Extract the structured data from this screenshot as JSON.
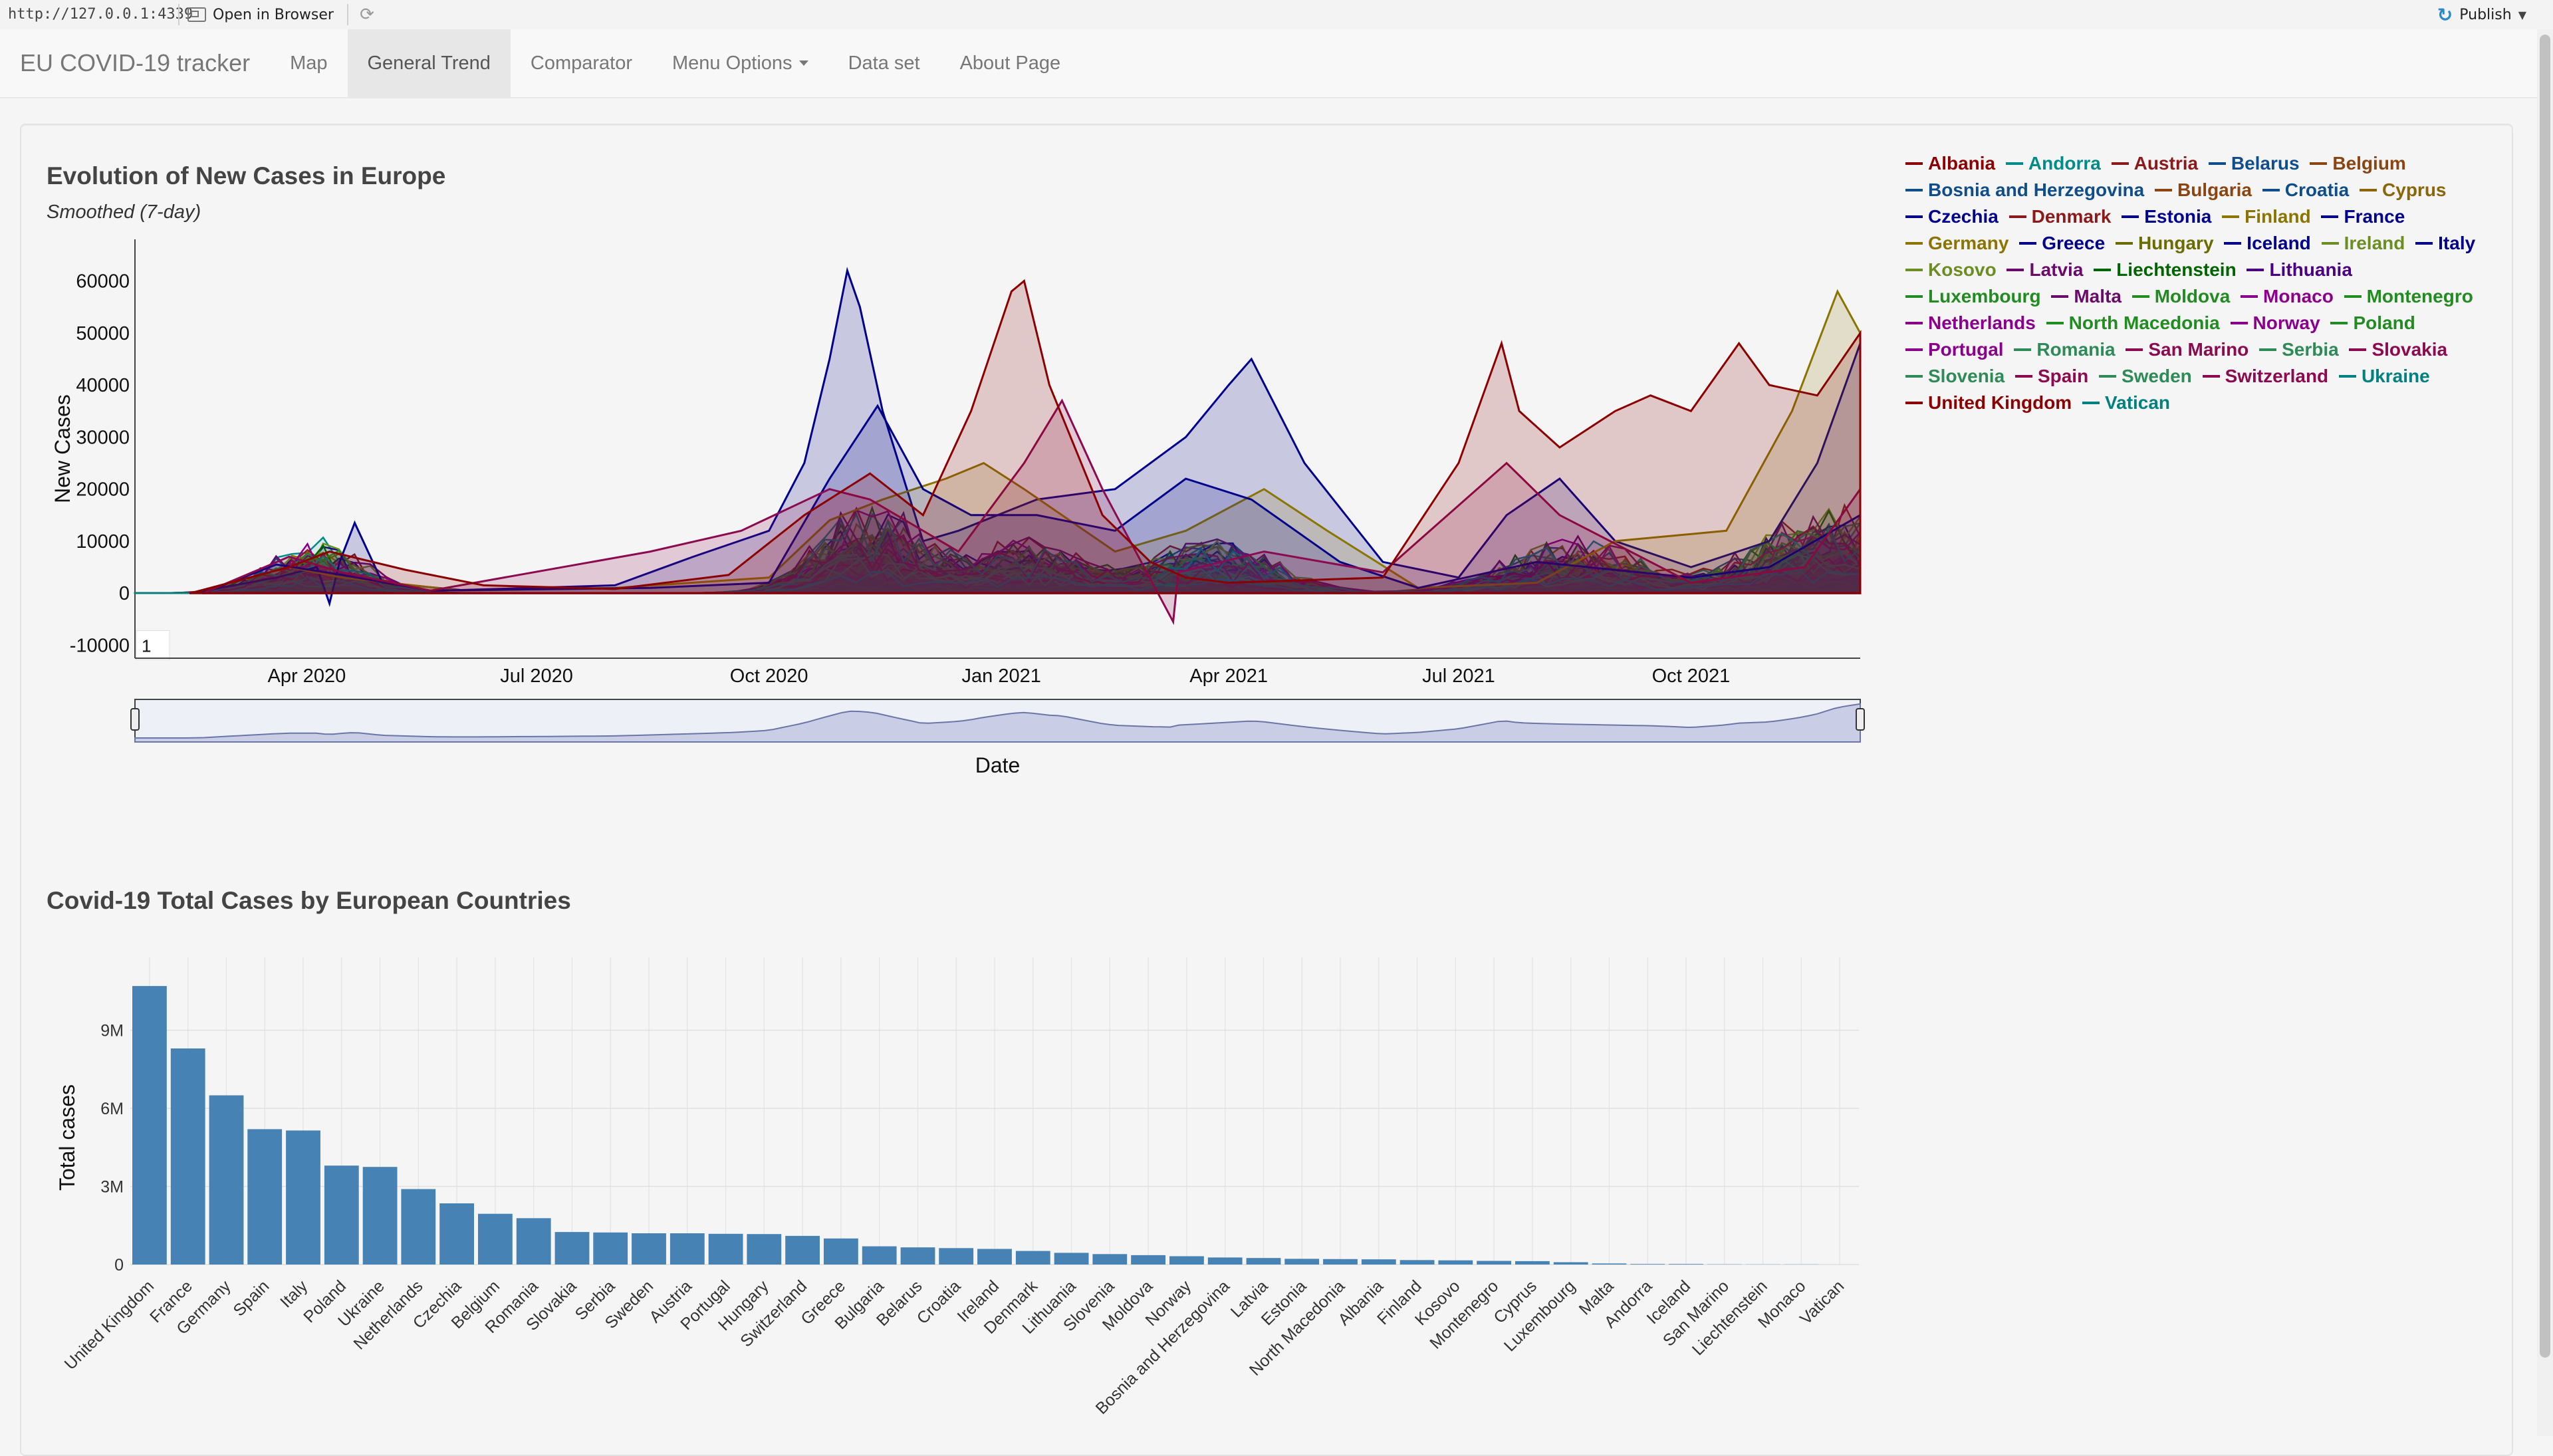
{
  "viewer": {
    "url": "http://127.0.0.1:4339",
    "open_in_browser": "Open in Browser",
    "publish": "Publish"
  },
  "navbar": {
    "brand": "EU COVID-19 tracker",
    "items": [
      {
        "label": "Map",
        "active": false
      },
      {
        "label": "General Trend",
        "active": true
      },
      {
        "label": "Comparator",
        "active": false
      },
      {
        "label": "Menu Options",
        "active": false,
        "dropdown": true
      },
      {
        "label": "Data set",
        "active": false
      },
      {
        "label": "About Page",
        "active": false
      }
    ]
  },
  "colors": {
    "bar": "#4682b4",
    "accent_nav_active": "#e7e7e7"
  },
  "chart_data": [
    {
      "type": "area",
      "title": "Evolution of New Cases in Europe",
      "subtitle": "Smoothed (7-day)",
      "xlabel": "Date",
      "ylabel": "New Cases",
      "yticks": [
        60000,
        50000,
        40000,
        30000,
        20000,
        10000,
        0,
        -10000
      ],
      "ylim": [
        -12500,
        68000
      ],
      "xlim": [
        "2020-01-24",
        "2021-12-07"
      ],
      "xticks": [
        {
          "label": "Apr 2020",
          "date": "2020-04-01"
        },
        {
          "label": "Jul 2020",
          "date": "2020-07-01"
        },
        {
          "label": "Oct 2020",
          "date": "2020-10-01"
        },
        {
          "label": "Jan 2021",
          "date": "2021-01-01"
        },
        {
          "label": "Apr 2021",
          "date": "2021-04-01"
        },
        {
          "label": "Jul 2021",
          "date": "2021-07-01"
        },
        {
          "label": "Oct 2021",
          "date": "2021-10-01"
        }
      ],
      "grid": false,
      "legend_position": "right",
      "input_box_value": "1",
      "series": [
        {
          "name": "Albania",
          "color": "#8b0000"
        },
        {
          "name": "Andorra",
          "color": "#008b8b"
        },
        {
          "name": "Austria",
          "color": "#8b1a1a"
        },
        {
          "name": "Belarus",
          "color": "#104e8b"
        },
        {
          "name": "Belgium",
          "color": "#8b4513"
        },
        {
          "name": "Bosnia and Herzegovina",
          "color": "#104e8b"
        },
        {
          "name": "Bulgaria",
          "color": "#8b4513"
        },
        {
          "name": "Croatia",
          "color": "#104e8b"
        },
        {
          "name": "Cyprus",
          "color": "#8b6508"
        },
        {
          "name": "Czechia",
          "color": "#00008b"
        },
        {
          "name": "Denmark",
          "color": "#8b1a1a"
        },
        {
          "name": "Estonia",
          "color": "#00008b"
        },
        {
          "name": "Finland",
          "color": "#8b7500"
        },
        {
          "name": "France",
          "color": "#00008b"
        },
        {
          "name": "Germany",
          "color": "#8b7500"
        },
        {
          "name": "Greece",
          "color": "#00008b"
        },
        {
          "name": "Hungary",
          "color": "#6b6b00"
        },
        {
          "name": "Iceland",
          "color": "#00008b"
        },
        {
          "name": "Ireland",
          "color": "#6b8e23"
        },
        {
          "name": "Italy",
          "color": "#00008b"
        },
        {
          "name": "Kosovo",
          "color": "#6b8e23"
        },
        {
          "name": "Latvia",
          "color": "#6a0a6a"
        },
        {
          "name": "Liechtenstein",
          "color": "#006400"
        },
        {
          "name": "Lithuania",
          "color": "#4b0082"
        },
        {
          "name": "Luxembourg",
          "color": "#228b22"
        },
        {
          "name": "Malta",
          "color": "#6a0a6a"
        },
        {
          "name": "Moldova",
          "color": "#228b22"
        },
        {
          "name": "Monaco",
          "color": "#8b008b"
        },
        {
          "name": "Montenegro",
          "color": "#228b22"
        },
        {
          "name": "Netherlands",
          "color": "#8b008b"
        },
        {
          "name": "North Macedonia",
          "color": "#228b22"
        },
        {
          "name": "Norway",
          "color": "#8b008b"
        },
        {
          "name": "Poland",
          "color": "#228b22"
        },
        {
          "name": "Portugal",
          "color": "#8b008b"
        },
        {
          "name": "Romania",
          "color": "#2e8b57"
        },
        {
          "name": "San Marino",
          "color": "#8b0a50"
        },
        {
          "name": "Serbia",
          "color": "#2e8b57"
        },
        {
          "name": "Slovakia",
          "color": "#8b0a50"
        },
        {
          "name": "Slovenia",
          "color": "#2e8b57"
        },
        {
          "name": "Spain",
          "color": "#8b0a50"
        },
        {
          "name": "Sweden",
          "color": "#2e8b57"
        },
        {
          "name": "Switzerland",
          "color": "#8b0a50"
        },
        {
          "name": "Ukraine",
          "color": "#008080"
        },
        {
          "name": "United Kingdom",
          "color": "#8b0000"
        },
        {
          "name": "Vatican",
          "color": "#008080"
        }
      ],
      "highlighted_series": {
        "France": [
          [
            "2020-02-15",
            0
          ],
          [
            "2020-03-20",
            3000
          ],
          [
            "2020-04-05",
            5000
          ],
          [
            "2020-04-10",
            -2000
          ],
          [
            "2020-04-14",
            6000
          ],
          [
            "2020-04-20",
            13500
          ],
          [
            "2020-05-01",
            2000
          ],
          [
            "2020-06-01",
            600
          ],
          [
            "2020-08-01",
            1500
          ],
          [
            "2020-09-01",
            7000
          ],
          [
            "2020-10-01",
            12000
          ],
          [
            "2020-10-15",
            25000
          ],
          [
            "2020-10-25",
            45000
          ],
          [
            "2020-11-01",
            62000
          ],
          [
            "2020-11-06",
            55000
          ],
          [
            "2020-11-15",
            35000
          ],
          [
            "2020-12-01",
            10000
          ],
          [
            "2020-12-15",
            12000
          ],
          [
            "2021-01-15",
            18000
          ],
          [
            "2021-02-15",
            20000
          ],
          [
            "2021-03-15",
            30000
          ],
          [
            "2021-04-01",
            40000
          ],
          [
            "2021-04-10",
            45000
          ],
          [
            "2021-05-01",
            25000
          ],
          [
            "2021-06-01",
            6000
          ],
          [
            "2021-07-01",
            3000
          ],
          [
            "2021-07-20",
            15000
          ],
          [
            "2021-08-10",
            22000
          ],
          [
            "2021-09-01",
            10000
          ],
          [
            "2021-10-01",
            5000
          ],
          [
            "2021-11-01",
            10000
          ],
          [
            "2021-11-20",
            25000
          ],
          [
            "2021-12-07",
            48000
          ]
        ],
        "United Kingdom": [
          [
            "2020-02-15",
            0
          ],
          [
            "2020-03-25",
            5000
          ],
          [
            "2020-04-10",
            8000
          ],
          [
            "2020-05-10",
            4500
          ],
          [
            "2020-06-10",
            1500
          ],
          [
            "2020-08-01",
            800
          ],
          [
            "2020-09-15",
            3500
          ],
          [
            "2020-10-15",
            15000
          ],
          [
            "2020-11-10",
            23000
          ],
          [
            "2020-12-01",
            15000
          ],
          [
            "2020-12-20",
            35000
          ],
          [
            "2021-01-05",
            58000
          ],
          [
            "2021-01-10",
            60000
          ],
          [
            "2021-01-20",
            40000
          ],
          [
            "2021-02-10",
            15000
          ],
          [
            "2021-03-01",
            6000
          ],
          [
            "2021-03-15",
            3000
          ],
          [
            "2021-04-01",
            2000
          ],
          [
            "2021-06-01",
            3000
          ],
          [
            "2021-07-01",
            25000
          ],
          [
            "2021-07-18",
            48000
          ],
          [
            "2021-07-25",
            35000
          ],
          [
            "2021-08-10",
            28000
          ],
          [
            "2021-09-01",
            35000
          ],
          [
            "2021-09-15",
            38000
          ],
          [
            "2021-10-01",
            35000
          ],
          [
            "2021-10-20",
            48000
          ],
          [
            "2021-11-01",
            40000
          ],
          [
            "2021-11-20",
            38000
          ],
          [
            "2021-12-07",
            50000
          ]
        ],
        "Germany": [
          [
            "2020-02-15",
            0
          ],
          [
            "2020-03-25",
            5000
          ],
          [
            "2020-04-15",
            3000
          ],
          [
            "2020-06-01",
            500
          ],
          [
            "2020-08-01",
            1000
          ],
          [
            "2020-10-01",
            3000
          ],
          [
            "2020-10-25",
            14000
          ],
          [
            "2020-11-15",
            18000
          ],
          [
            "2020-12-10",
            22000
          ],
          [
            "2020-12-25",
            25000
          ],
          [
            "2021-01-10",
            20000
          ],
          [
            "2021-02-15",
            8000
          ],
          [
            "2021-03-15",
            12000
          ],
          [
            "2021-04-15",
            20000
          ],
          [
            "2021-05-10",
            12000
          ],
          [
            "2021-06-15",
            1000
          ],
          [
            "2021-08-01",
            2000
          ],
          [
            "2021-09-01",
            10000
          ],
          [
            "2021-10-15",
            12000
          ],
          [
            "2021-11-10",
            35000
          ],
          [
            "2021-11-28",
            58000
          ],
          [
            "2021-12-07",
            50000
          ]
        ],
        "Italy": [
          [
            "2020-02-20",
            0
          ],
          [
            "2020-03-20",
            5500
          ],
          [
            "2020-04-15",
            3500
          ],
          [
            "2020-05-20",
            500
          ],
          [
            "2020-08-15",
            1000
          ],
          [
            "2020-10-01",
            2000
          ],
          [
            "2020-10-25",
            22000
          ],
          [
            "2020-11-13",
            36000
          ],
          [
            "2020-12-01",
            20000
          ],
          [
            "2020-12-20",
            15000
          ],
          [
            "2021-01-15",
            15000
          ],
          [
            "2021-02-15",
            12000
          ],
          [
            "2021-03-15",
            22000
          ],
          [
            "2021-04-10",
            18000
          ],
          [
            "2021-05-15",
            6000
          ],
          [
            "2021-06-15",
            1000
          ],
          [
            "2021-08-01",
            6000
          ],
          [
            "2021-10-01",
            3000
          ],
          [
            "2021-11-01",
            5000
          ],
          [
            "2021-12-07",
            15000
          ]
        ],
        "Spain": [
          [
            "2020-02-20",
            0
          ],
          [
            "2020-03-25",
            7000
          ],
          [
            "2020-04-15",
            4000
          ],
          [
            "2020-05-20",
            500
          ],
          [
            "2020-08-15",
            8000
          ],
          [
            "2020-09-20",
            12000
          ],
          [
            "2020-10-25",
            20000
          ],
          [
            "2020-11-10",
            18000
          ],
          [
            "2020-12-15",
            8000
          ],
          [
            "2021-01-10",
            25000
          ],
          [
            "2021-01-25",
            37000
          ],
          [
            "2021-02-10",
            20000
          ],
          [
            "2021-03-10",
            -5500
          ],
          [
            "2021-03-12",
            4000
          ],
          [
            "2021-04-15",
            8000
          ],
          [
            "2021-06-01",
            4000
          ],
          [
            "2021-07-20",
            25000
          ],
          [
            "2021-08-10",
            15000
          ],
          [
            "2021-10-01",
            2000
          ],
          [
            "2021-11-15",
            5000
          ],
          [
            "2021-12-07",
            20000
          ]
        ]
      }
    },
    {
      "type": "bar",
      "title": "Covid-19 Total Cases by European Countries",
      "xlabel": "",
      "ylabel": "Total cases",
      "ylim": [
        0,
        11800000
      ],
      "yticks": [
        {
          "value": 0,
          "label": "0"
        },
        {
          "value": 3000000,
          "label": "3M"
        },
        {
          "value": 6000000,
          "label": "6M"
        },
        {
          "value": 9000000,
          "label": "9M"
        }
      ],
      "grid": true,
      "categories": [
        "United Kingdom",
        "France",
        "Germany",
        "Spain",
        "Italy",
        "Poland",
        "Ukraine",
        "Netherlands",
        "Czechia",
        "Belgium",
        "Romania",
        "Slovakia",
        "Serbia",
        "Sweden",
        "Austria",
        "Portugal",
        "Hungary",
        "Switzerland",
        "Greece",
        "Bulgaria",
        "Belarus",
        "Croatia",
        "Ireland",
        "Denmark",
        "Lithuania",
        "Slovenia",
        "Moldova",
        "Norway",
        "Bosnia and Herzegovina",
        "Latvia",
        "Estonia",
        "North Macedonia",
        "Albania",
        "Finland",
        "Kosovo",
        "Montenegro",
        "Cyprus",
        "Luxembourg",
        "Malta",
        "Andorra",
        "Iceland",
        "San Marino",
        "Liechtenstein",
        "Monaco",
        "Vatican"
      ],
      "values": [
        10700000,
        8300000,
        6500000,
        5200000,
        5150000,
        3800000,
        3750000,
        2900000,
        2350000,
        1950000,
        1780000,
        1250000,
        1230000,
        1200000,
        1200000,
        1180000,
        1170000,
        1100000,
        1000000,
        700000,
        660000,
        630000,
        600000,
        520000,
        450000,
        400000,
        360000,
        320000,
        270000,
        250000,
        220000,
        210000,
        200000,
        170000,
        160000,
        140000,
        130000,
        90000,
        40000,
        20000,
        20000,
        8000,
        6000,
        4000,
        30
      ]
    }
  ]
}
